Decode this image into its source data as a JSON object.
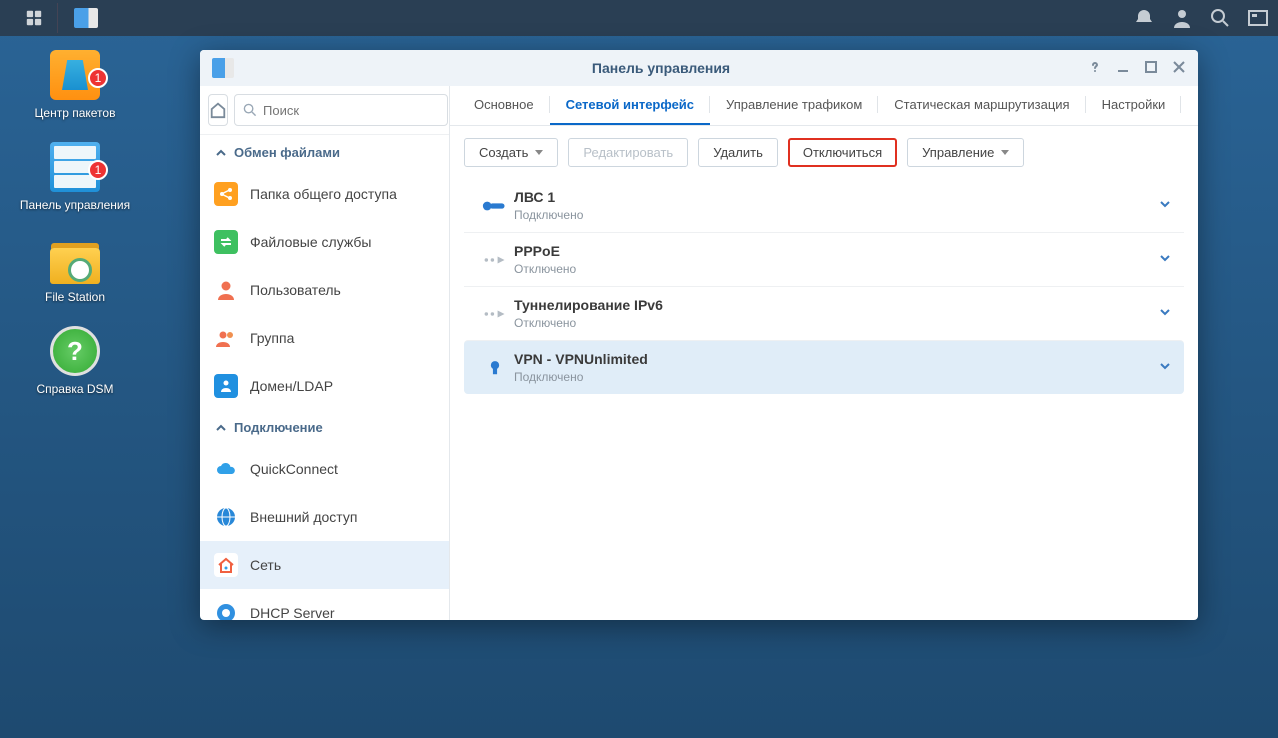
{
  "taskbar": {},
  "desktop": {
    "items": [
      {
        "label": "Центр\nпакетов",
        "badge": "1",
        "name": "pkg-center-icon"
      },
      {
        "label": "Панель управления",
        "badge": "1",
        "name": "control-panel-icon"
      },
      {
        "label": "File Station",
        "badge": null,
        "name": "file-station-icon"
      },
      {
        "label": "Справка DSM",
        "badge": null,
        "name": "dsm-help-icon"
      }
    ]
  },
  "window": {
    "title": "Панель управления",
    "search_placeholder": "Поиск",
    "sections": {
      "fileshare": "Обмен файлами",
      "connectivity": "Подключение"
    },
    "sidebar": [
      {
        "group": "fileshare",
        "label": "Папка общего доступа",
        "name": "shared-folder",
        "active": false,
        "icon": "share"
      },
      {
        "group": "fileshare",
        "label": "Файловые службы",
        "name": "file-services",
        "active": false,
        "icon": "swap"
      },
      {
        "group": "fileshare",
        "label": "Пользователь",
        "name": "user",
        "active": false,
        "icon": "user"
      },
      {
        "group": "fileshare",
        "label": "Группа",
        "name": "group",
        "active": false,
        "icon": "users"
      },
      {
        "group": "fileshare",
        "label": "Домен/LDAP",
        "name": "domain-ldap",
        "active": false,
        "icon": "ldap"
      },
      {
        "group": "connectivity",
        "label": "QuickConnect",
        "name": "quickconnect",
        "active": false,
        "icon": "cloud"
      },
      {
        "group": "connectivity",
        "label": "Внешний доступ",
        "name": "external-access",
        "active": false,
        "icon": "globe"
      },
      {
        "group": "connectivity",
        "label": "Сеть",
        "name": "network",
        "active": true,
        "icon": "house"
      },
      {
        "group": "connectivity",
        "label": "DHCP Server",
        "name": "dhcp-server",
        "active": false,
        "icon": "dhcp"
      }
    ],
    "tabs": [
      {
        "label": "Основное",
        "active": false
      },
      {
        "label": "Сетевой интерфейс",
        "active": true
      },
      {
        "label": "Управление трафиком",
        "active": false
      },
      {
        "label": "Статическая маршрутизация",
        "active": false
      },
      {
        "label": "Настройки",
        "active": false
      }
    ],
    "toolbar": {
      "create": "Создать",
      "edit": "Редактировать",
      "delete": "Удалить",
      "disconnect": "Отключиться",
      "manage": "Управление"
    },
    "interfaces": [
      {
        "name": "ЛВС 1",
        "status": "Подключено",
        "icon": "wired",
        "connected": true,
        "selected": false
      },
      {
        "name": "PPPoE",
        "status": "Отключено",
        "icon": "ppp",
        "connected": false,
        "selected": false
      },
      {
        "name": "Туннелирование IPv6",
        "status": "Отключено",
        "icon": "ppp",
        "connected": false,
        "selected": false
      },
      {
        "name": "VPN - VPNUnlimited",
        "status": "Подключено",
        "icon": "vpn",
        "connected": true,
        "selected": true
      }
    ]
  }
}
